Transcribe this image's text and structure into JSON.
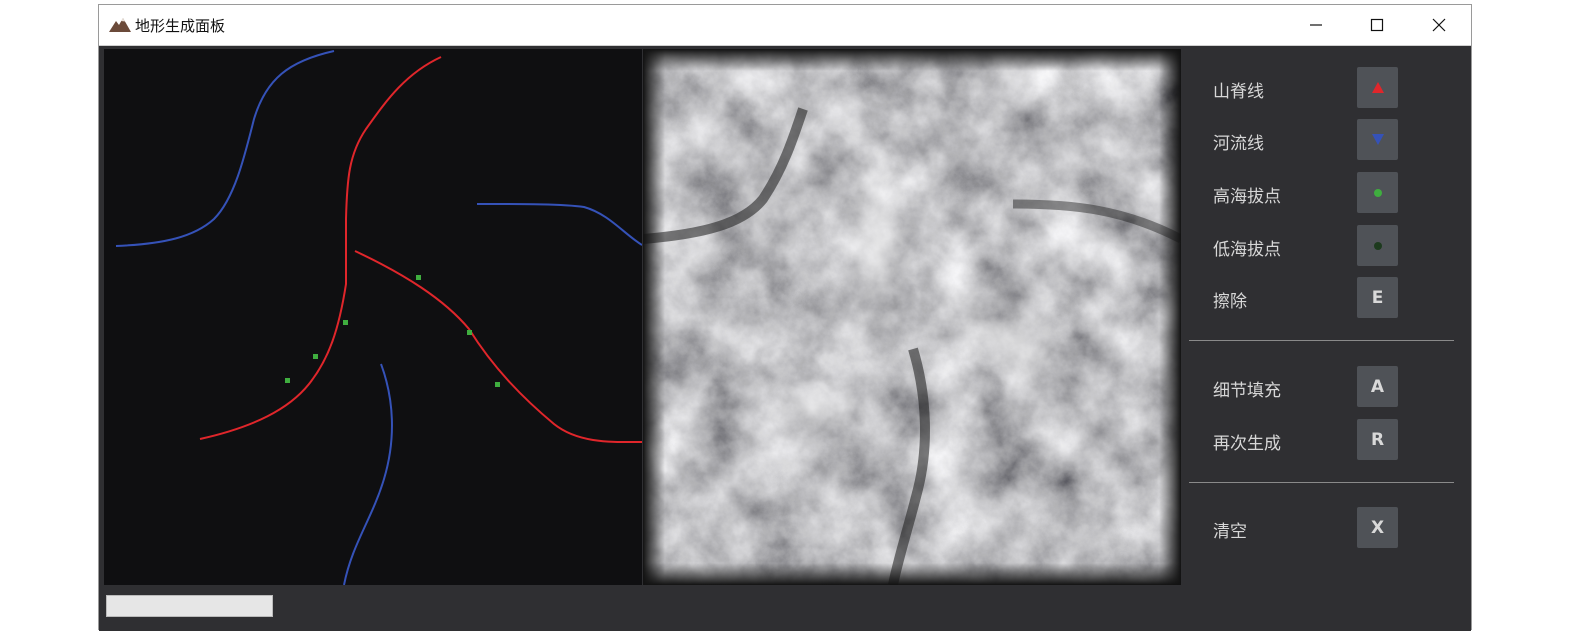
{
  "window": {
    "title": "地形生成面板"
  },
  "tools": {
    "ridge": {
      "label": "山脊线",
      "icon": "red-up-triangle-icon"
    },
    "river": {
      "label": "河流线",
      "icon": "blue-down-triangle-icon"
    },
    "high_point": {
      "label": "高海拔点",
      "icon": "green-dot-icon"
    },
    "low_point": {
      "label": "低海拔点",
      "icon": "dark-dot-icon"
    },
    "erase": {
      "label": "擦除",
      "glyph": "E"
    },
    "detail_fill": {
      "label": "细节填充",
      "glyph": "A"
    },
    "regenerate": {
      "label": "再次生成",
      "glyph": "R"
    },
    "clear": {
      "label": "清空",
      "glyph": "X"
    }
  },
  "colors": {
    "ridge": "#e0262b",
    "river": "#3552b8",
    "high_point": "#3fae3f",
    "low_point": "#1d3a1d"
  },
  "progress": {
    "value": 0
  }
}
